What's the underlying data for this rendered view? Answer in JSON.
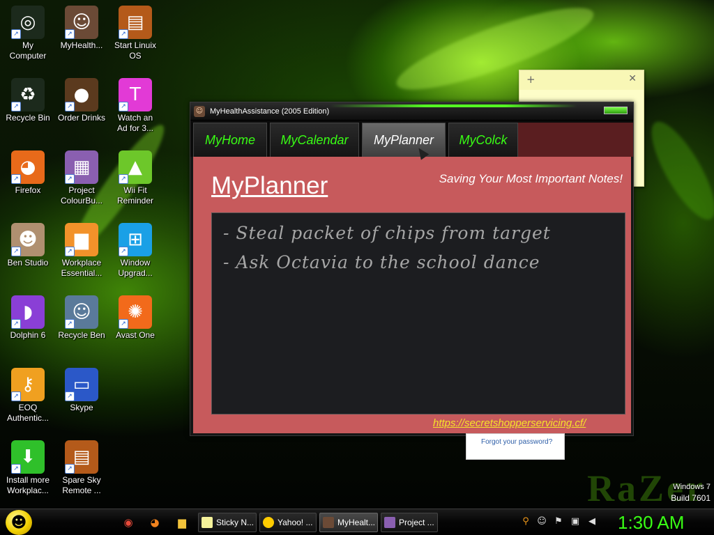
{
  "desktop": {
    "icons": [
      {
        "label": "My\nComputer",
        "icon": "razer-computer-icon",
        "color": "#1c2a1c"
      },
      {
        "label": "MyHealth...",
        "icon": "pixel-avatar-icon",
        "color": "#6b4a36"
      },
      {
        "label": "Start Linuix\nOS",
        "icon": "console-icon",
        "color": "#b45a1a"
      },
      {
        "label": "Recycle Bin",
        "icon": "razer-recycle-icon",
        "color": "#1c2a1c"
      },
      {
        "label": "Order Drinks",
        "icon": "coffee-bean-icon",
        "color": "#5b3a1e"
      },
      {
        "label": "Watch an\nAd for 3...",
        "icon": "t-logo-icon",
        "color": "#e23ad6"
      },
      {
        "label": "Firefox",
        "icon": "firefox-icon",
        "color": "#e86a1a"
      },
      {
        "label": "Project\nColourBu...",
        "icon": "collage-icon",
        "color": "#8a5fb0"
      },
      {
        "label": "Wii Fit\nReminder",
        "icon": "pixel-tree-icon",
        "color": "#6dc72a"
      },
      {
        "label": "Ben Studio",
        "icon": "cat-icon",
        "color": "#b09070"
      },
      {
        "label": "Workplace\nEssential...",
        "icon": "folder-orange-icon",
        "color": "#f2922a"
      },
      {
        "label": "Window\nUpgrad...",
        "icon": "windows-logo-icon",
        "color": "#1aa0e6"
      },
      {
        "label": "Dolphin 6",
        "icon": "dolphin-icon",
        "color": "#8a3fd6"
      },
      {
        "label": "Recycle Ben",
        "icon": "person-photo-icon",
        "color": "#5a7a9a"
      },
      {
        "label": "Avast One",
        "icon": "avast-icon",
        "color": "#f26a1b"
      },
      {
        "label": "EOQ\nAuthentic...",
        "icon": "key-badge-icon",
        "color": "#f0a020"
      },
      {
        "label": "Skype",
        "icon": "window-app-icon",
        "color": "#2b58c8"
      },
      {
        "label": "Install more\nWorkplac...",
        "icon": "download-arrow-icon",
        "color": "#2fc02a"
      },
      {
        "label": "Spare Sky\nRemote ...",
        "icon": "console-icon",
        "color": "#b45a1a"
      }
    ]
  },
  "sticky_note": {
    "add_glyph": "+",
    "close_glyph": "✕"
  },
  "app": {
    "window_title": "MyHealthAssistance (2005 Edition)",
    "tabs": [
      {
        "label": "MyHome",
        "active": false
      },
      {
        "label": "MyCalendar",
        "active": false
      },
      {
        "label": "MyPlanner",
        "active": true
      },
      {
        "label": "MyColck",
        "active": false
      }
    ],
    "page_heading": "MyPlanner",
    "tagline": "Saving Your Most Important Notes!",
    "notes": [
      "- Steal packet of chips from target",
      "- Ask Octavia to the school dance"
    ],
    "footer_link": "https://secretshopperservicing.cf/"
  },
  "forgot_password": {
    "link_text": "Forgot your password?"
  },
  "watermark": {
    "line1": "Windows 7",
    "line2": "Build 7601"
  },
  "taskbar": {
    "pinned": [
      {
        "name": "chrome-icon",
        "glyph": "◉",
        "color": "#e84a3a"
      },
      {
        "name": "firefox-icon",
        "glyph": "◕",
        "color": "#f0821e"
      },
      {
        "name": "explorer-folder-icon",
        "glyph": "▆",
        "color": "#f2c33a"
      }
    ],
    "buttons": [
      {
        "label": "Sticky N...",
        "color": "#f5f29b",
        "active": false
      },
      {
        "label": "Yahoo! ...",
        "color": "#ffcc00",
        "active": false
      },
      {
        "label": "MyHealt...",
        "color": "#6b4a36",
        "active": true
      },
      {
        "label": "Project ...",
        "color": "#8a5fb0",
        "active": false
      }
    ],
    "clock": "1:30 AM"
  },
  "colors": {
    "accent_green": "#39ff14",
    "content_bg": "#c75a5c",
    "link_yellow": "#f6e22a"
  }
}
